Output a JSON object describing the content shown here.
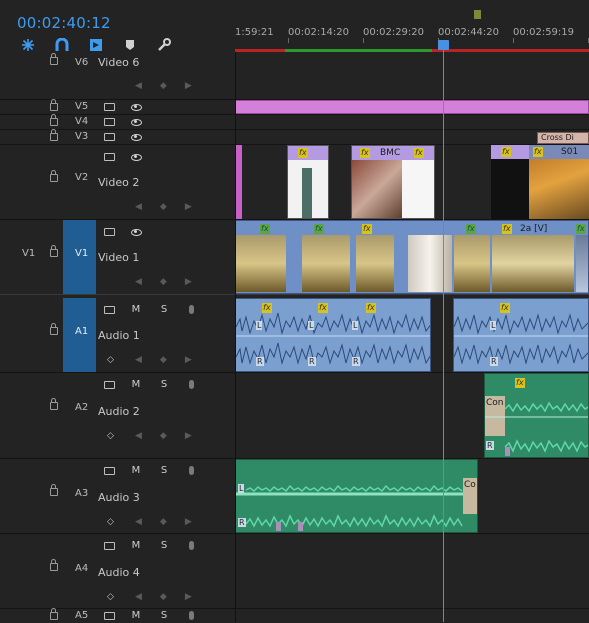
{
  "timecode": "00:02:40:12",
  "toolbar": {
    "icons": [
      "snap-icon",
      "linked-selection-icon",
      "add-marker-icon",
      "marker-icon",
      "wrench-icon"
    ]
  },
  "ruler": {
    "labels": [
      "1:59:21",
      "00:02:14:20",
      "00:02:29:20",
      "00:02:44:20",
      "00:02:59:19"
    ]
  },
  "tracks": {
    "v6": {
      "label": "V6",
      "name": "Video 6"
    },
    "v5": {
      "label": "V5"
    },
    "v4": {
      "label": "V4"
    },
    "v3": {
      "label": "V3"
    },
    "v2": {
      "label": "V2",
      "name": "Video 2"
    },
    "v1": {
      "label": "V1",
      "source": "V1",
      "name": "Video 1"
    },
    "a1": {
      "label": "A1",
      "source": "A1",
      "name": "Audio 1"
    },
    "a2": {
      "label": "A2",
      "name": "Audio 2"
    },
    "a3": {
      "label": "A3",
      "name": "Audio 3"
    },
    "a4": {
      "label": "A4",
      "name": "Audio 4"
    },
    "a5": {
      "label": "A5"
    }
  },
  "audio_buttons": {
    "mute": "M",
    "solo": "S"
  },
  "clips": {
    "v3_transition": "Cross Di",
    "v2_bmc": "BMC",
    "v2_s01": "S01",
    "v1_2a": "2a [V]",
    "a2_con": "Con",
    "a3_co": "Co",
    "fx": "fx",
    "left": "L",
    "right": "R"
  },
  "colors": {
    "timecode": "#3d9cf0",
    "source_patch": "#1f5d93",
    "v5_clip": "#d47fd8",
    "video_clip": "#6f8fc7",
    "audio_clip": "#7ba0d0",
    "green_audio": "#2f8a66",
    "playhead": "#4a90e2",
    "work_area_red": "#b22222",
    "work_area_green": "#2e9a2e"
  }
}
